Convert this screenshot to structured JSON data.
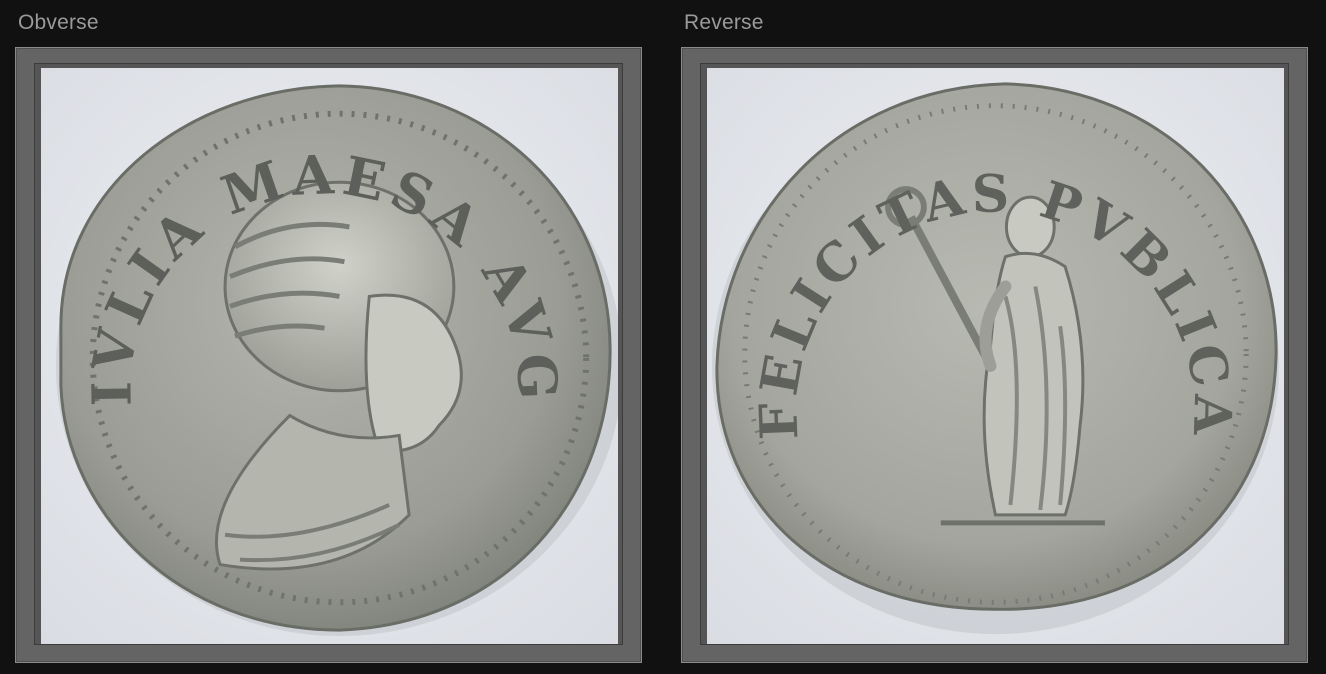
{
  "obverse": {
    "label": "Obverse",
    "legend": "IVLIA MAESA AVG",
    "coin_colors": {
      "rim": "#8f918b",
      "field": "#9a9c95",
      "relief": "#c2c4bd",
      "shadow": "#5f615c"
    }
  },
  "reverse": {
    "label": "Reverse",
    "legend": "FELICITAS PVBLICA",
    "coin_colors": {
      "rim": "#8f918b",
      "field": "#a3a59e",
      "relief": "#c6c8c1",
      "shadow": "#62645e"
    }
  },
  "colors": {
    "background": "#111111",
    "frame": "#646464",
    "label_text": "#9a9a9a",
    "photo_backdrop": "#e9ebef"
  }
}
